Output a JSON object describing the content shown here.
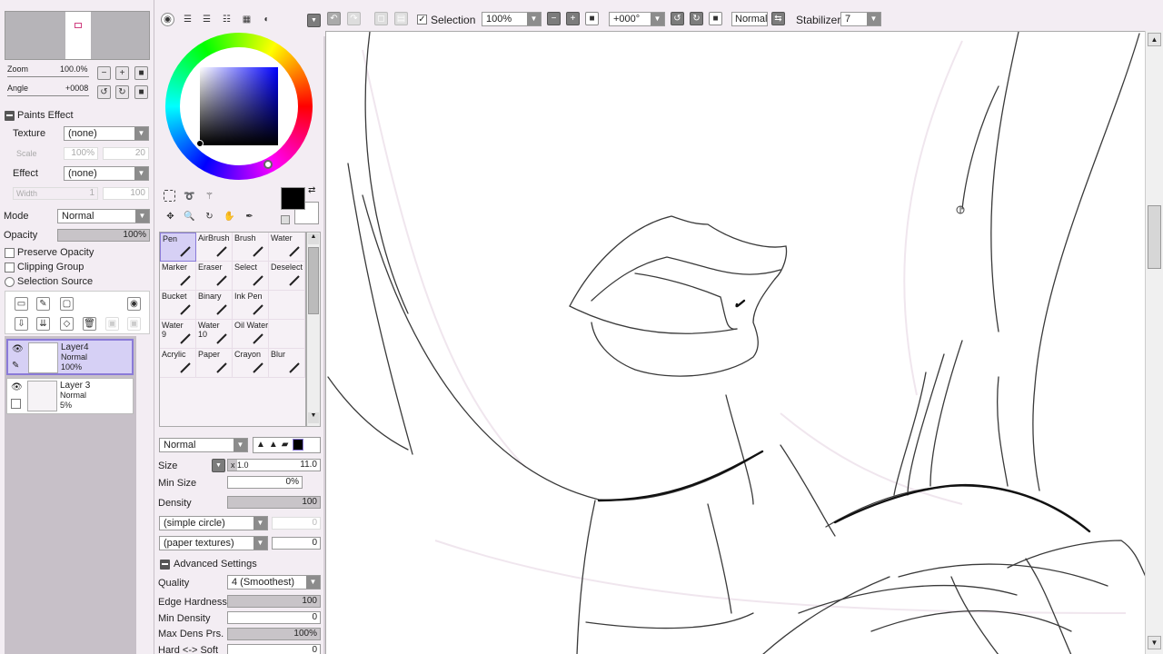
{
  "navigator": {
    "zoom_label": "Zoom",
    "zoom_value": "100.0%",
    "angle_label": "Angle",
    "angle_value": "+0008"
  },
  "paints_effect": {
    "title": "Paints Effect",
    "texture_label": "Texture",
    "texture_value": "(none)",
    "scale_label": "Scale",
    "scale_value": "100%",
    "scale_num": "20",
    "effect_label": "Effect",
    "effect_value": "(none)",
    "width_label": "Width",
    "width_value": "1",
    "width_num": "100"
  },
  "layer_props": {
    "mode_label": "Mode",
    "mode_value": "Normal",
    "opacity_label": "Opacity",
    "opacity_value": "100%",
    "preserve_opacity": "Preserve Opacity",
    "clipping_group": "Clipping Group",
    "selection_source": "Selection Source"
  },
  "layers": [
    {
      "name": "Layer4",
      "mode": "Normal",
      "opacity": "100%",
      "selected": true
    },
    {
      "name": "Layer 3",
      "mode": "Normal",
      "opacity": "5%",
      "selected": false
    }
  ],
  "tools": [
    {
      "label": "Pen",
      "sub": ""
    },
    {
      "label": "AirBrush",
      "sub": ""
    },
    {
      "label": "Brush",
      "sub": ""
    },
    {
      "label": "Water",
      "sub": ""
    },
    {
      "label": "Marker",
      "sub": ""
    },
    {
      "label": "Eraser",
      "sub": ""
    },
    {
      "label": "Select",
      "sub": ""
    },
    {
      "label": "Deselect",
      "sub": ""
    },
    {
      "label": "Bucket",
      "sub": ""
    },
    {
      "label": "Binary",
      "sub": ""
    },
    {
      "label": "Ink Pen",
      "sub": ""
    },
    {
      "label": "",
      "sub": ""
    },
    {
      "label": "Water",
      "sub": "9"
    },
    {
      "label": "Water",
      "sub": "10"
    },
    {
      "label": "Oil Water",
      "sub": ""
    },
    {
      "label": "",
      "sub": ""
    },
    {
      "label": "Acrylic",
      "sub": ""
    },
    {
      "label": "Paper",
      "sub": ""
    },
    {
      "label": "Crayon",
      "sub": ""
    },
    {
      "label": "Blur",
      "sub": ""
    }
  ],
  "brush": {
    "blend_mode": "Normal",
    "size_label": "Size",
    "size_mult": "x 1.0",
    "size_value": "11.0",
    "min_size_label": "Min Size",
    "min_size_value": "0%",
    "density_label": "Density",
    "density_value": "100",
    "shape": "(simple circle)",
    "shape_num": "0",
    "texture": "(paper textures)",
    "texture_num": "0",
    "advanced_title": "Advanced Settings",
    "quality_label": "Quality",
    "quality_value": "4 (Smoothest)",
    "edge_label": "Edge Hardness",
    "edge_value": "100",
    "min_density_label": "Min Density",
    "min_density_value": "0",
    "max_dens_label": "Max Dens Prs.",
    "max_dens_value": "100%",
    "hard_soft_label": "Hard <-> Soft",
    "hard_soft_value": "0"
  },
  "toolbar": {
    "selection_label": "Selection",
    "zoom_value": "100%",
    "rotation_value": "+000°",
    "blend_value": "Normal",
    "stabilizer_label": "Stabilizer",
    "stabilizer_value": "7"
  },
  "colors": {
    "primary": "#000000",
    "secondary": "#ffffff",
    "accent": "#8a7ad8",
    "panel": "#f3edf3"
  }
}
